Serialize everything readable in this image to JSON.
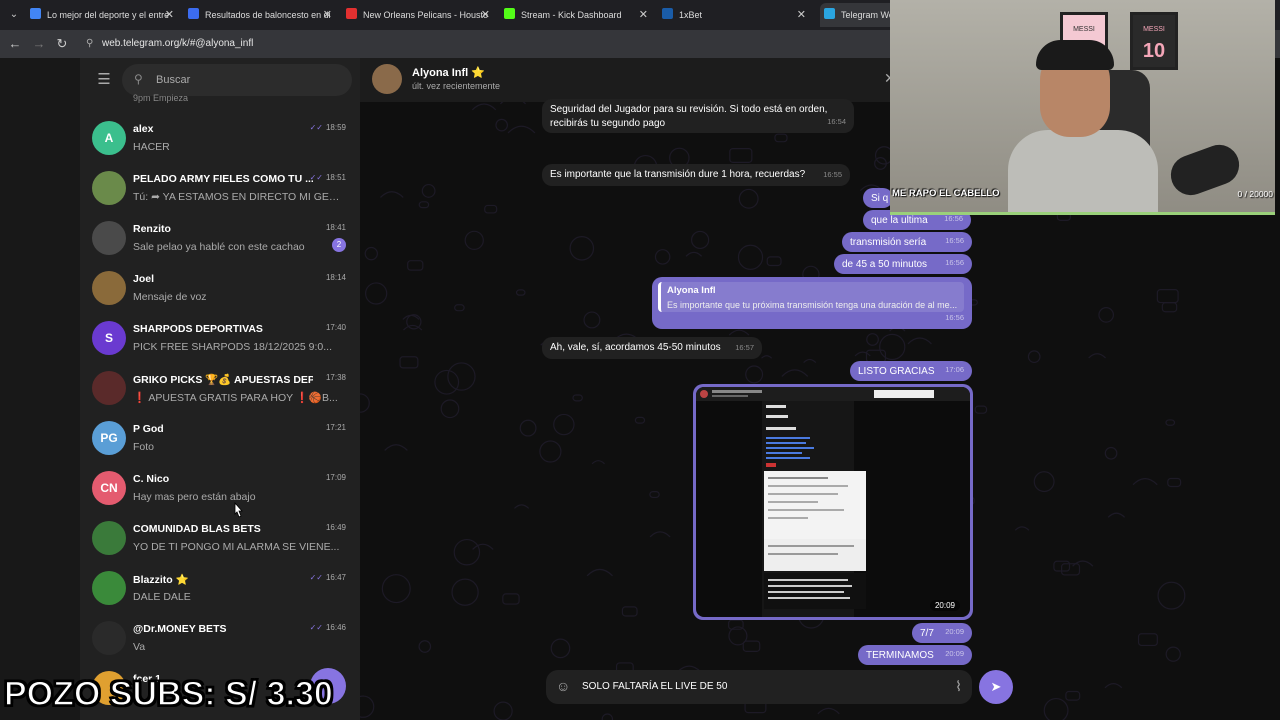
{
  "browser": {
    "tabs": [
      {
        "label": "Lo mejor del deporte y el entre",
        "color": "#4285f4"
      },
      {
        "label": "Resultados de baloncesto en di",
        "color": "#3c6cf0"
      },
      {
        "label": "New Orleans Pelicans - Housto",
        "color": "#e23030"
      },
      {
        "label": "Stream - Kick Dashboard",
        "color": "#53fc18"
      },
      {
        "label": "1xBet",
        "color": "#1a5ca8"
      },
      {
        "label": "Telegram Web",
        "color": "#2aa5e0"
      }
    ],
    "url": "web.telegram.org/k/#@alyona_infl"
  },
  "sidebar": {
    "search_placeholder": "Buscar",
    "partial_preview": "9pm Empieza",
    "chats": [
      {
        "name": "alex",
        "preview": "HACER",
        "time": "18:59",
        "initials": "A",
        "avatar_color": "#3bbf8d",
        "read": true
      },
      {
        "name": "PELADO ARMY FIELES COMO TU ...",
        "preview": "Tú: ➦ YA ESTAMOS EN DIRECTO MI GENT...",
        "time": "18:51",
        "initials": "",
        "avatar_color": "#6a8a4a",
        "read": true
      },
      {
        "name": "Renzito",
        "preview": "Sale pelao ya hablé con este cachao",
        "time": "18:41",
        "initials": "",
        "avatar_color": "#4a4a4a",
        "unread": "2"
      },
      {
        "name": "Joel",
        "preview": "Mensaje de voz",
        "time": "18:14",
        "initials": "",
        "avatar_color": "#8a6a3a"
      },
      {
        "name": "SHARPODS DEPORTIVAS",
        "preview": "PICK FREE SHARPODS 18/12/2025 9:0...",
        "time": "17:40",
        "initials": "S",
        "avatar_color": "#6a3ad0"
      },
      {
        "name": "GRIKO PICKS 🏆💰 APUESTAS DEPO...",
        "preview": "❗ APUESTA GRATIS PARA HOY ❗🏀B...",
        "time": "17:38",
        "initials": "",
        "avatar_color": "#5a2a2a"
      },
      {
        "name": "P God",
        "preview": "Foto",
        "time": "17:21",
        "initials": "PG",
        "avatar_color": "#5a9ed6"
      },
      {
        "name": "C. Nico",
        "preview": "Hay mas pero están abajo",
        "time": "17:09",
        "initials": "CN",
        "avatar_color": "#e45b6f"
      },
      {
        "name": "COMUNIDAD BLAS BETS",
        "preview": "YO DE TI PONGO MI ALARMA SE VIENE...",
        "time": "16:49",
        "initials": "",
        "avatar_color": "#3a7a3a"
      },
      {
        "name": "Blazzito ⭐",
        "preview": "DALE DALE",
        "time": "16:47",
        "initials": "",
        "avatar_color": "#3a8a3a",
        "read": true
      },
      {
        "name": "@Dr.MONEY BETS",
        "preview": "Va",
        "time": "16:46",
        "initials": "",
        "avatar_color": "#2a2a2a",
        "read": true
      },
      {
        "name": "fcer 1",
        "preview": "",
        "time": "",
        "initials": "",
        "avatar_color": "#e0a030"
      }
    ]
  },
  "chat": {
    "name": "Alyona Infl ⭐",
    "status": "últ. vez recientemente",
    "messages": [
      {
        "dir": "in",
        "text": "Seguridad del Jugador para su revisión. Si todo está en orden,\nrecibirás tu segundo pago",
        "time": "16:54"
      },
      {
        "dir": "in",
        "text": "Es importante que la transmisión dure 1 hora, recuerdas?",
        "time": "16:55"
      },
      {
        "dir": "out",
        "text": "Si q",
        "time": ""
      },
      {
        "dir": "out",
        "text": "que la ultima",
        "time": "16:56"
      },
      {
        "dir": "out",
        "text": "transmisión sería",
        "time": "16:56"
      },
      {
        "dir": "out",
        "text": "de 45 a 50 minutos",
        "time": "16:56"
      },
      {
        "dir": "out",
        "quote_name": "Alyona Infl",
        "quote_text": "Es importante que tu próxima transmisión tenga una duración de al me...",
        "text": "",
        "time": "16:56"
      },
      {
        "dir": "in",
        "text": "Ah, vale, sí, acordamos 45-50 minutos",
        "time": "16:57"
      },
      {
        "dir": "out",
        "text": "LISTO GRACIAS",
        "time": "17:06"
      },
      {
        "dir": "out",
        "photo": true,
        "text": "",
        "time": "20:09"
      },
      {
        "dir": "out",
        "text": "7/7",
        "time": "20:09"
      },
      {
        "dir": "out",
        "text": "TERMINAMOS",
        "time": "20:09"
      }
    ],
    "photo_time": "20:09",
    "composer_text": "SOLO FALTARÍA EL LIVE DE 50"
  },
  "webcam": {
    "caption": "ME RAPO EL CABELLO",
    "counter": "0 / 20000",
    "jersey_text": "MESSI",
    "jersey_number": "10"
  },
  "overlay": {
    "text": "POZO SUBS: S/ 3.30"
  },
  "colors": {
    "accent": "#8774e1",
    "outgoing": "#766ac8",
    "incoming": "#212121"
  }
}
